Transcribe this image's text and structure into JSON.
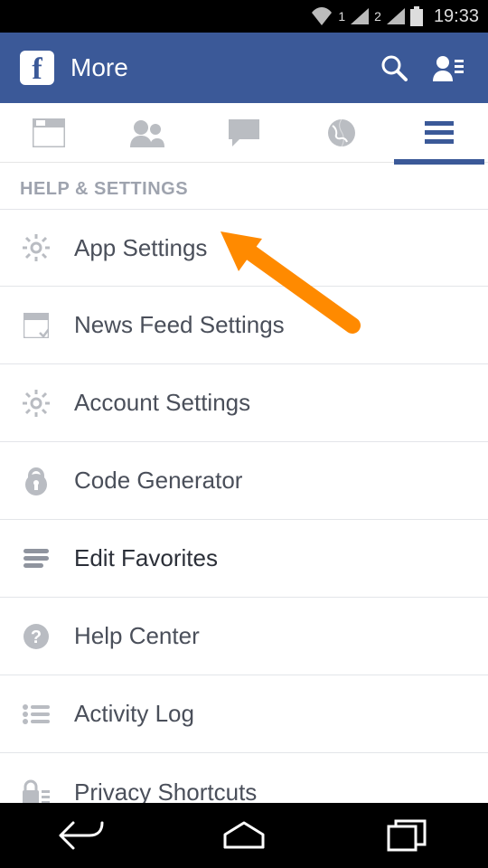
{
  "status_bar": {
    "sim1": "1",
    "sim2": "2",
    "time": "19:33"
  },
  "header": {
    "app_logo_letter": "f",
    "title": "More"
  },
  "section": {
    "title": "HELP & SETTINGS"
  },
  "rows": [
    {
      "icon": "gear",
      "label": "App Settings"
    },
    {
      "icon": "feed",
      "label": "News Feed Settings"
    },
    {
      "icon": "gear",
      "label": "Account Settings"
    },
    {
      "icon": "lock",
      "label": "Code Generator"
    },
    {
      "icon": "lines",
      "label": "Edit Favorites"
    },
    {
      "icon": "help",
      "label": "Help Center"
    },
    {
      "icon": "list",
      "label": "Activity Log"
    },
    {
      "icon": "padlock",
      "label": "Privacy Shortcuts"
    }
  ],
  "annotation": {
    "points_to_row_index": 0
  }
}
